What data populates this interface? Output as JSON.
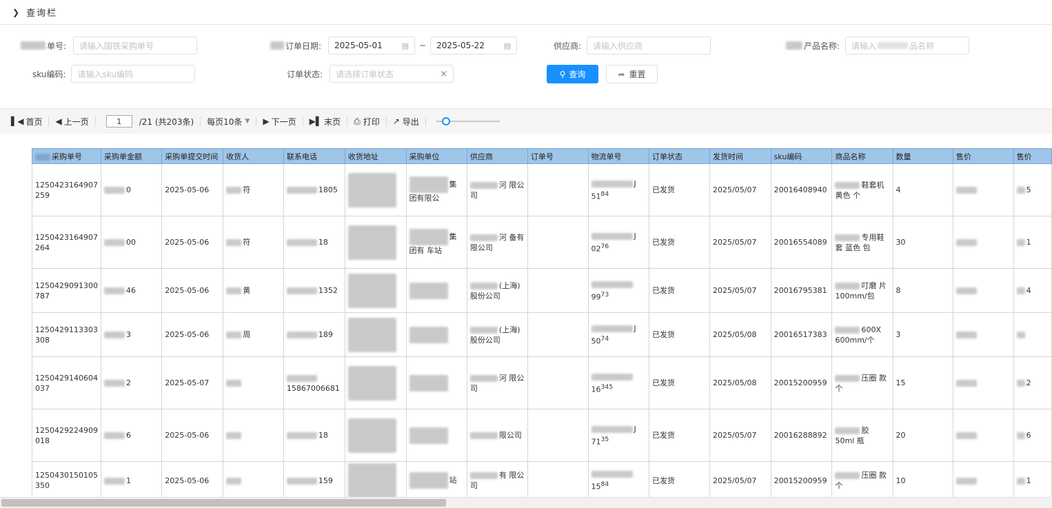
{
  "query_panel": {
    "title": "查询栏",
    "toggle_icon": "chevron-down-icon"
  },
  "filters": {
    "order_no_label": "单号:",
    "order_no_placeholder": "请输入国铁采购单号",
    "order_date_label": "订单日期:",
    "date_from": "2025-05-01",
    "date_to": "2025-05-22",
    "date_separator": "~",
    "supplier_label": "供应商:",
    "supplier_placeholder": "请输入供应商",
    "product_label": "产品名称:",
    "product_placeholder_a": "请输入",
    "product_placeholder_b": "品名称",
    "sku_label": "sku编码:",
    "sku_placeholder": "请输入sku编码",
    "status_label": "订单状态:",
    "status_placeholder": "请选择订单状态",
    "clear_glyph": "×",
    "query_button": "查询",
    "reset_button": "重置"
  },
  "pager": {
    "first": "首页",
    "prev": "上一页",
    "current_page": "1",
    "total": "/21  (共203条)",
    "page_size": "每页10条",
    "next": "下一页",
    "last": "末页",
    "print": "打印",
    "export": "导出",
    "zoom_level": 0.1
  },
  "table": {
    "columns": [
      "采购单号",
      "采购单金额",
      "采购单提交时间",
      "收货人",
      "联系电话",
      "收货地址",
      "采购单位",
      "供应商",
      "订单号",
      "物流单号",
      "订单状态",
      "发货时间",
      "sku编码",
      "商品名称",
      "数量",
      "售价",
      "售价"
    ],
    "rows": [
      {
        "po": "1250423164907 259",
        "amount": "0",
        "submit": "2025-05-06",
        "receiver": "符",
        "phone": "180",
        "phone_tail": "5",
        "unit": "集团有限公",
        "supplier": "河 限公司",
        "logistics": "J 51",
        "logistics_tail": "84",
        "status": "已发货",
        "ship": "2025/05/07",
        "sku": "20016408940",
        "product": "鞋套机 黄色 个",
        "qty": "4",
        "price2": "5"
      },
      {
        "po": "1250423164907 264",
        "amount": "00",
        "submit": "2025-05-06",
        "receiver": "符",
        "phone": "18",
        "phone_tail": "",
        "unit": "集团有 车站",
        "supplier": "河 备有限公司",
        "logistics": "J 02",
        "logistics_tail": "76",
        "status": "已发货",
        "ship": "2025/05/07",
        "sku": "20016554089",
        "product": "专用鞋套 蓝色 包",
        "qty": "30",
        "price2": "1"
      },
      {
        "po": "1250429091300 787",
        "amount": "46",
        "submit": "2025-05-06",
        "receiver": "黄",
        "phone": "135",
        "phone_tail": "2",
        "unit": "",
        "supplier": "(上海) 股份公司",
        "logistics": "99",
        "logistics_tail": "73",
        "status": "已发货",
        "ship": "2025/05/07",
        "sku": "20016795381",
        "product": "叮磨 片100mm/包",
        "qty": "8",
        "price2": "4"
      },
      {
        "po": "1250429113303 308",
        "amount": "3",
        "submit": "2025-05-06",
        "receiver": "周",
        "phone": "189",
        "phone_tail": "",
        "unit": "",
        "supplier": "(上海) 股份公司",
        "logistics": "J 50",
        "logistics_tail": "74",
        "status": "已发货",
        "ship": "2025/05/08",
        "sku": "20016517383",
        "product": "600X 600mm/个",
        "qty": "3",
        "price2": ""
      },
      {
        "po": "1250429140604 037",
        "amount": "2",
        "submit": "2025-05-07",
        "receiver": "",
        "phone": "15867006681",
        "phone_tail": "",
        "unit": "",
        "supplier": "河 限公司",
        "logistics": "16",
        "logistics_tail": "345",
        "status": "已发货",
        "ship": "2025/05/08",
        "sku": "20015200959",
        "product": "压圈 款 个",
        "qty": "15",
        "price2": "2"
      },
      {
        "po": "1250429224909 018",
        "amount": "6",
        "submit": "2025-05-06",
        "receiver": "",
        "phone": "18",
        "phone_tail": "",
        "unit": "",
        "supplier": "限公司",
        "logistics": "J 71",
        "logistics_tail": "35",
        "status": "已发货",
        "ship": "2025/05/07",
        "sku": "20016288892",
        "product": "胶 50ml 瓶",
        "qty": "20",
        "price2": "6"
      },
      {
        "po": "1250430150105 350",
        "amount": "1",
        "submit": "2025-05-06",
        "receiver": "",
        "phone": "159",
        "phone_tail": "",
        "unit": "站",
        "supplier": "有 限公司",
        "logistics": "15",
        "logistics_tail": "84",
        "status": "已发货",
        "ship": "2025/05/07",
        "sku": "20015200959",
        "product": "压圈 款 个",
        "qty": "10",
        "price2": "1"
      }
    ]
  }
}
